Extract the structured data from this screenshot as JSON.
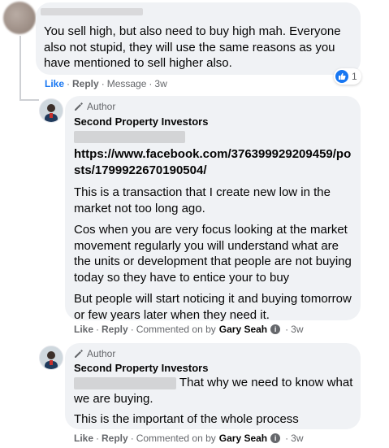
{
  "comment1": {
    "text": "You sell high, but also need to buy high mah. Everyone also not stupid, they will use the same reasons as you have mentioned to sell higher also.",
    "actions": {
      "like": "Like",
      "reply": "Reply",
      "message": "Message",
      "time": "3w"
    },
    "reaction_count": "1"
  },
  "reply1": {
    "badge": "Author",
    "page_name": "Second Property Investors",
    "link": "https://www.facebook.com/376399929209459/posts/1799922670190504/",
    "paragraphs": [
      "This is a transaction that I create new low in the market not too long ago.",
      "Cos when you are very focus looking at the market movement regularly you will understand what are the units or development that people are not buying today so they have to entice your to buy",
      "But people will start noticing it and buying tomorrow or few years later when they need it."
    ],
    "actions": {
      "like": "Like",
      "reply": "Reply",
      "commented_on": "Commented on by",
      "by_name": "Gary Seah",
      "time": "3w"
    }
  },
  "reply2": {
    "badge": "Author",
    "page_name": "Second Property Investors",
    "text_inline": "That why we need to know what",
    "text_cont": "we are buying.",
    "paragraph2": "This is the important of the whole process",
    "actions": {
      "like": "Like",
      "reply": "Reply",
      "commented_on": "Commented on by",
      "by_name": "Gary Seah",
      "time": "3w"
    }
  },
  "colors": {
    "bubble": "#f0f2f5",
    "meta": "#65676b",
    "like_blue": "#1877f2"
  }
}
